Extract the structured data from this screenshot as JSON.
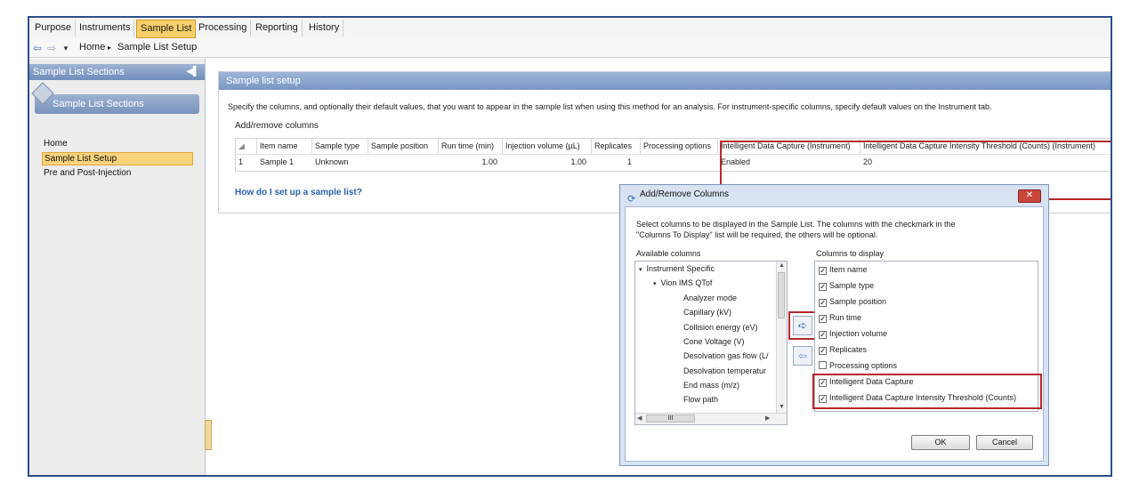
{
  "menu": {
    "tabs": [
      "Purpose",
      "Instruments",
      "Sample List",
      "Processing",
      "Reporting",
      "History"
    ],
    "active": "Sample List"
  },
  "breadcrumb": {
    "home": "Home",
    "separator": "▸",
    "current": "Sample List Setup"
  },
  "left_panel": {
    "header": "Sample List Sections",
    "group": "Sample List Sections",
    "items": [
      "Home",
      "Sample List Setup",
      "Pre and Post-Injection"
    ],
    "selected": "Sample List Setup"
  },
  "main": {
    "header": "Sample list setup",
    "description": "Specify the columns, and optionally their default values, that you want to appear in the sample list when using this method for an analysis. For instrument-specific columns, specify default values on the Instrument tab.",
    "add_remove_label": "Add/remove columns",
    "grid": {
      "columns": [
        "Item name",
        "Sample type",
        "Sample position",
        "Run time (min)",
        "Injection volume (µL)",
        "Replicates",
        "Processing options",
        "Intelligent Data Capture (Instrument)",
        "Intelligent Data Capture Intensity Threshold (Counts) (Instrument)"
      ],
      "rows": [
        {
          "index": "1",
          "cells": [
            "Sample 1",
            "Unknown",
            "",
            "1.00",
            "1.00",
            "1",
            "",
            "Enabled",
            "20"
          ]
        }
      ]
    },
    "help_link": "How do I set up a sample list?"
  },
  "dialog": {
    "title": "Add/Remove Columns",
    "instruction_line1": "Select columns to be displayed in the Sample List. The columns with the checkmark in the",
    "instruction_line2": "\"Columns To Display\" list will be required, the others will be optional.",
    "available_label": "Available columns",
    "display_label": "Columns to display",
    "available_tree": {
      "root": "Instrument Specific",
      "child": "Vion IMS QTof",
      "leaves": [
        "Analyzer mode",
        "Capillary (kV)",
        "Collision energy (eV)",
        "Cone Voltage (V)",
        "Desolvation gas flow (L/",
        "Desolvation temperatur",
        "End mass (m/z)",
        "Flow path"
      ]
    },
    "display_columns": [
      {
        "label": "Item name",
        "checked": true
      },
      {
        "label": "Sample type",
        "checked": true
      },
      {
        "label": "Sample position",
        "checked": true
      },
      {
        "label": "Run time",
        "checked": true
      },
      {
        "label": "Injection volume",
        "checked": true
      },
      {
        "label": "Replicates",
        "checked": true
      },
      {
        "label": "Processing options",
        "checked": false
      },
      {
        "label": "Intelligent Data Capture",
        "checked": true
      },
      {
        "label": "Intelligent Data Capture Intensity Threshold (Counts)",
        "checked": true
      }
    ],
    "scroll_mark": "III",
    "ok": "OK",
    "cancel": "Cancel",
    "close_glyph": "✕"
  },
  "colors": {
    "accent": "#f6cf6a",
    "header": "#7996c4",
    "highlight": "#b8262a",
    "link": "#2a62b0"
  }
}
